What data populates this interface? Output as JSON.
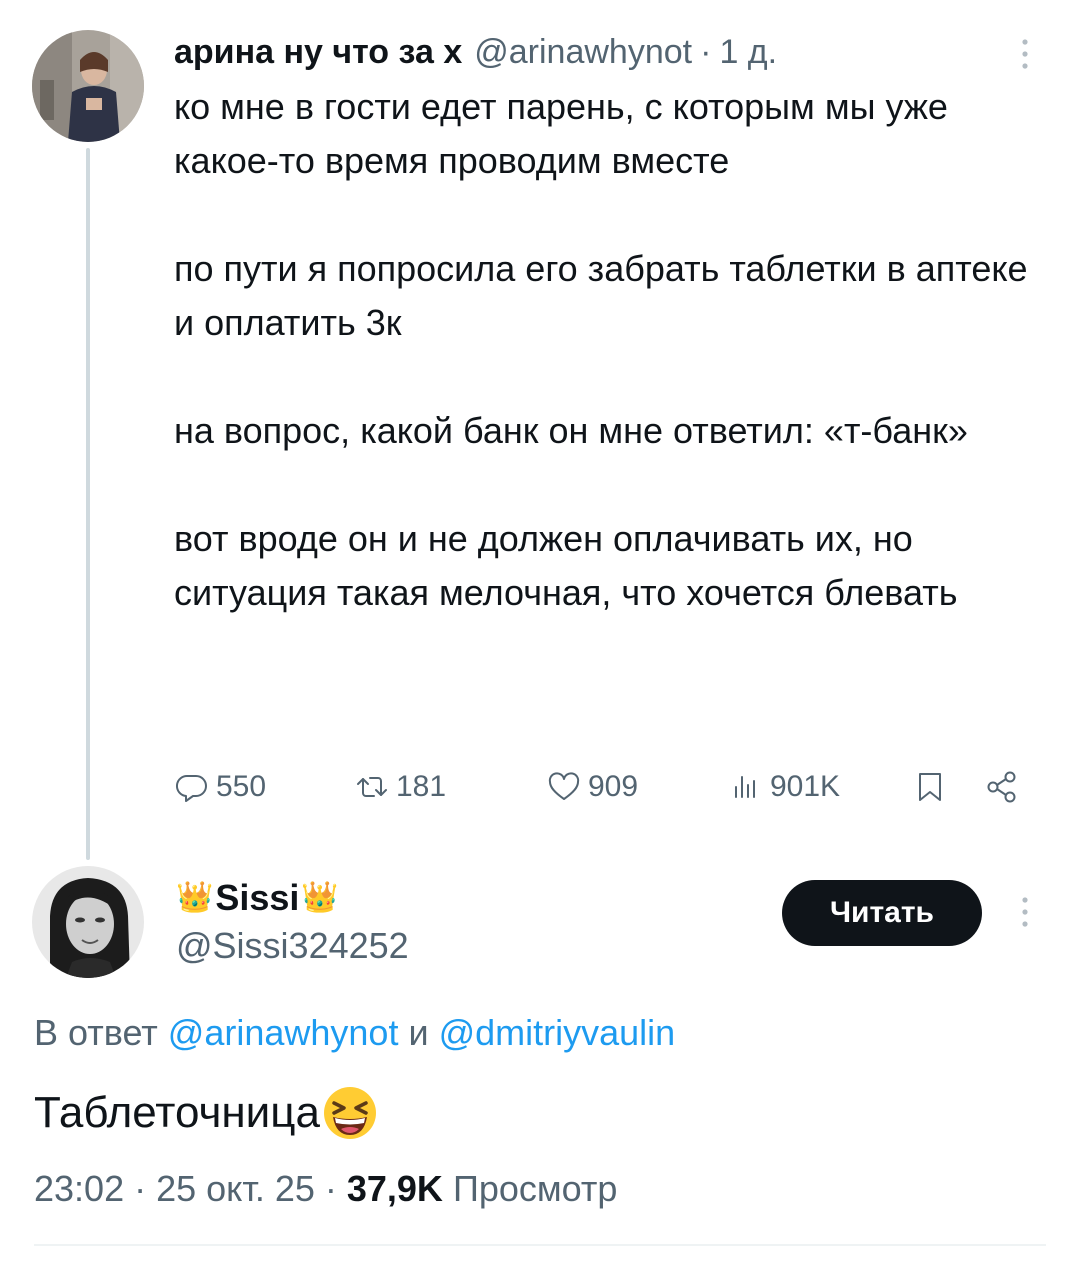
{
  "tweet": {
    "author_name": "арина ну что за х",
    "handle": "@arinawhynot",
    "separator": "·",
    "time_ago": "1 д.",
    "paragraphs": [
      "ко мне в гости едет парень, с которым мы уже какое-то время проводим вместе",
      "по пути я попросила его забрать таблетки в аптеке и оплатить 3к",
      "на вопрос, какой банк он мне ответил: «т-банк»",
      "вот вроде он и не должен оплачивать их, но ситуация такая мелочная, что хочется блевать"
    ],
    "actions": {
      "replies": "550",
      "retweets": "181",
      "likes": "909",
      "views": "901K"
    }
  },
  "reply": {
    "display_name": "Sissi",
    "name_emoji": "👑",
    "handle": "@Sissi324252",
    "follow_label": "Читать",
    "reply_prefix": "В ответ",
    "reply_to_1": "@arinawhynot",
    "reply_conjunction": "и",
    "reply_to_2": "@dmitriyvaulin",
    "text": "Таблеточница",
    "emoji_name": "laughing-face-emoji",
    "time": "23:02",
    "date": "25 окт. 25",
    "views_count": "37,9K",
    "views_label": "Просмотр",
    "separator": "·"
  },
  "colors": {
    "text": "#0f1419",
    "secondary": "#536471",
    "link": "#1d9bf0",
    "thread_line": "#cfd9de",
    "button_bg": "#0f1419"
  }
}
